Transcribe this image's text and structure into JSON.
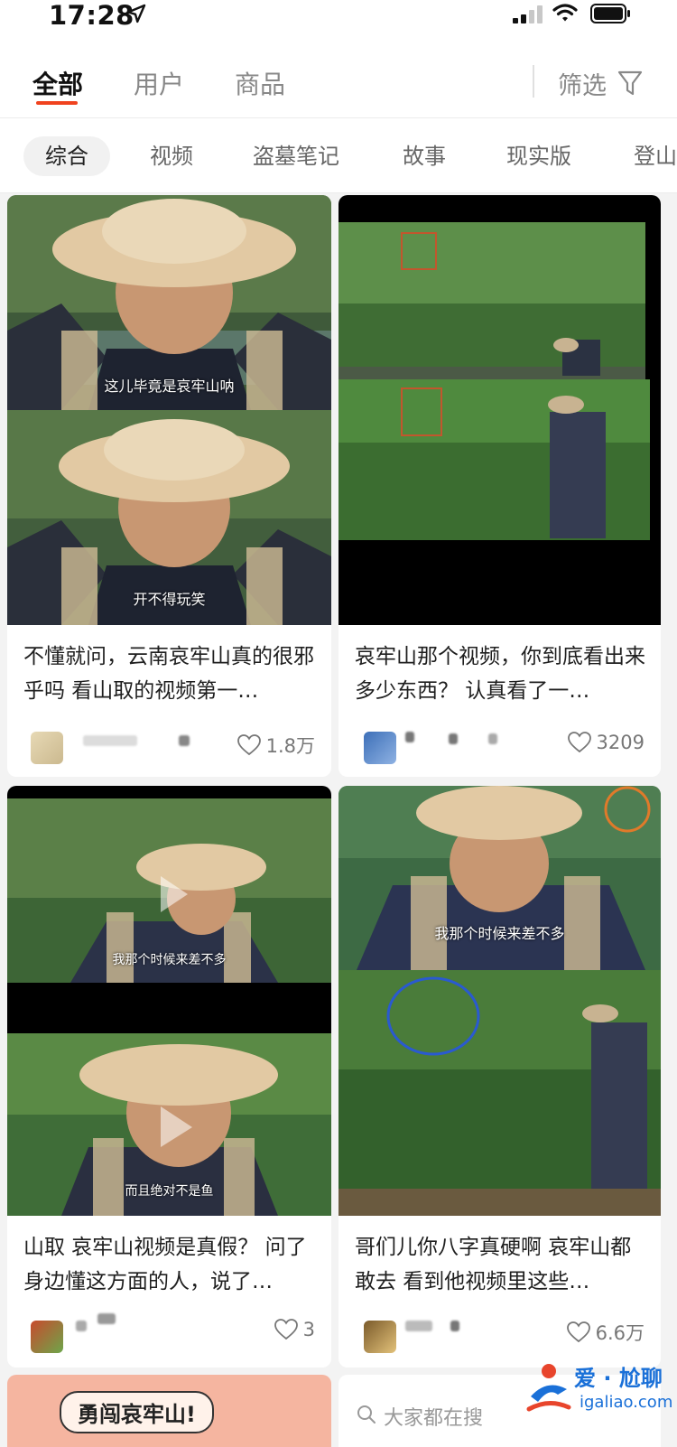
{
  "status_bar": {
    "time": "17:28"
  },
  "top_tabs": {
    "tabs": [
      "全部",
      "用户",
      "商品"
    ],
    "active": "全部",
    "filter_label": "筛选"
  },
  "chips": {
    "items": [
      "综合",
      "视频",
      "盗墓笔记",
      "故事",
      "现实版",
      "登山"
    ],
    "active": "综合"
  },
  "cards": [
    {
      "subtitles": [
        "这儿毕竟是哀牢山呐",
        "开不得玩笑"
      ],
      "title": "不懂就问，云南哀牢山真的很邪乎吗 看山取的视频第一…",
      "likes": "1.8万"
    },
    {
      "subtitles": [],
      "title": "哀牢山那个视频，你到底看出来多少东西？ 认真看了一…",
      "likes": "3209"
    },
    {
      "subtitles": [
        "我那个时候来差不多",
        "而且绝对不是鱼"
      ],
      "title": "山取 哀牢山视频是真假？ 问了身边懂这方面的人，说了…",
      "likes": "3"
    },
    {
      "subtitles": [
        "我那个时候来差不多"
      ],
      "title": "哥们儿你八字真硬啊 哀牢山都敢去 看到他视频里这些…",
      "likes": "6.6万"
    }
  ],
  "bottom": {
    "promo_text": "勇闯哀牢山!",
    "search_hint": "大家都在搜"
  },
  "watermark": {
    "line1": "爱 · 尬聊",
    "line2": "igaliao.com"
  },
  "colors": {
    "accent": "#f0421e",
    "page_background": "#f3f3f3"
  }
}
